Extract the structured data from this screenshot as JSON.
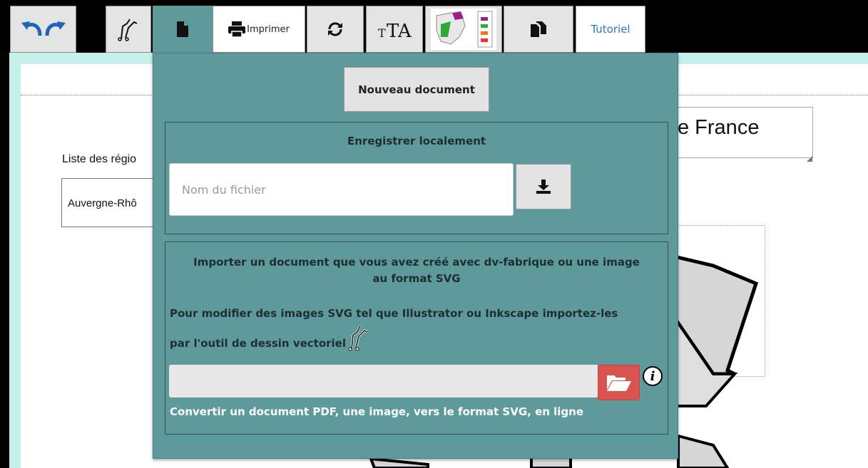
{
  "toolbar": {
    "undo_icon": "undo-icon",
    "redo_icon": "redo-icon",
    "print_label": "Imprimer",
    "tutorial_label": "Tutoriel",
    "accent_active": "#5e9a9b"
  },
  "background": {
    "title_partial": "e France",
    "list_label_partial": "Liste des régio",
    "select_value_partial": "Auvergne-Rhô"
  },
  "panel": {
    "new_document_label": "Nouveau document",
    "save": {
      "title": "Enregistrer localement",
      "filename_placeholder": "Nom du fichier",
      "filename_value": ""
    },
    "import": {
      "line1a": "Importer un document que vous avez créé avec dv-fabrique ou une image",
      "line1b": "au format SVG",
      "line2": "Pour modifier des images SVG tel que Illustrator ou Inkscape importez-les",
      "line3": "par l'outil de dessin vectoriel",
      "info_label": "i",
      "convert_link": "Convertir un document PDF, une image, vers le format SVG, en ligne",
      "browse_color": "#d9534f"
    }
  }
}
